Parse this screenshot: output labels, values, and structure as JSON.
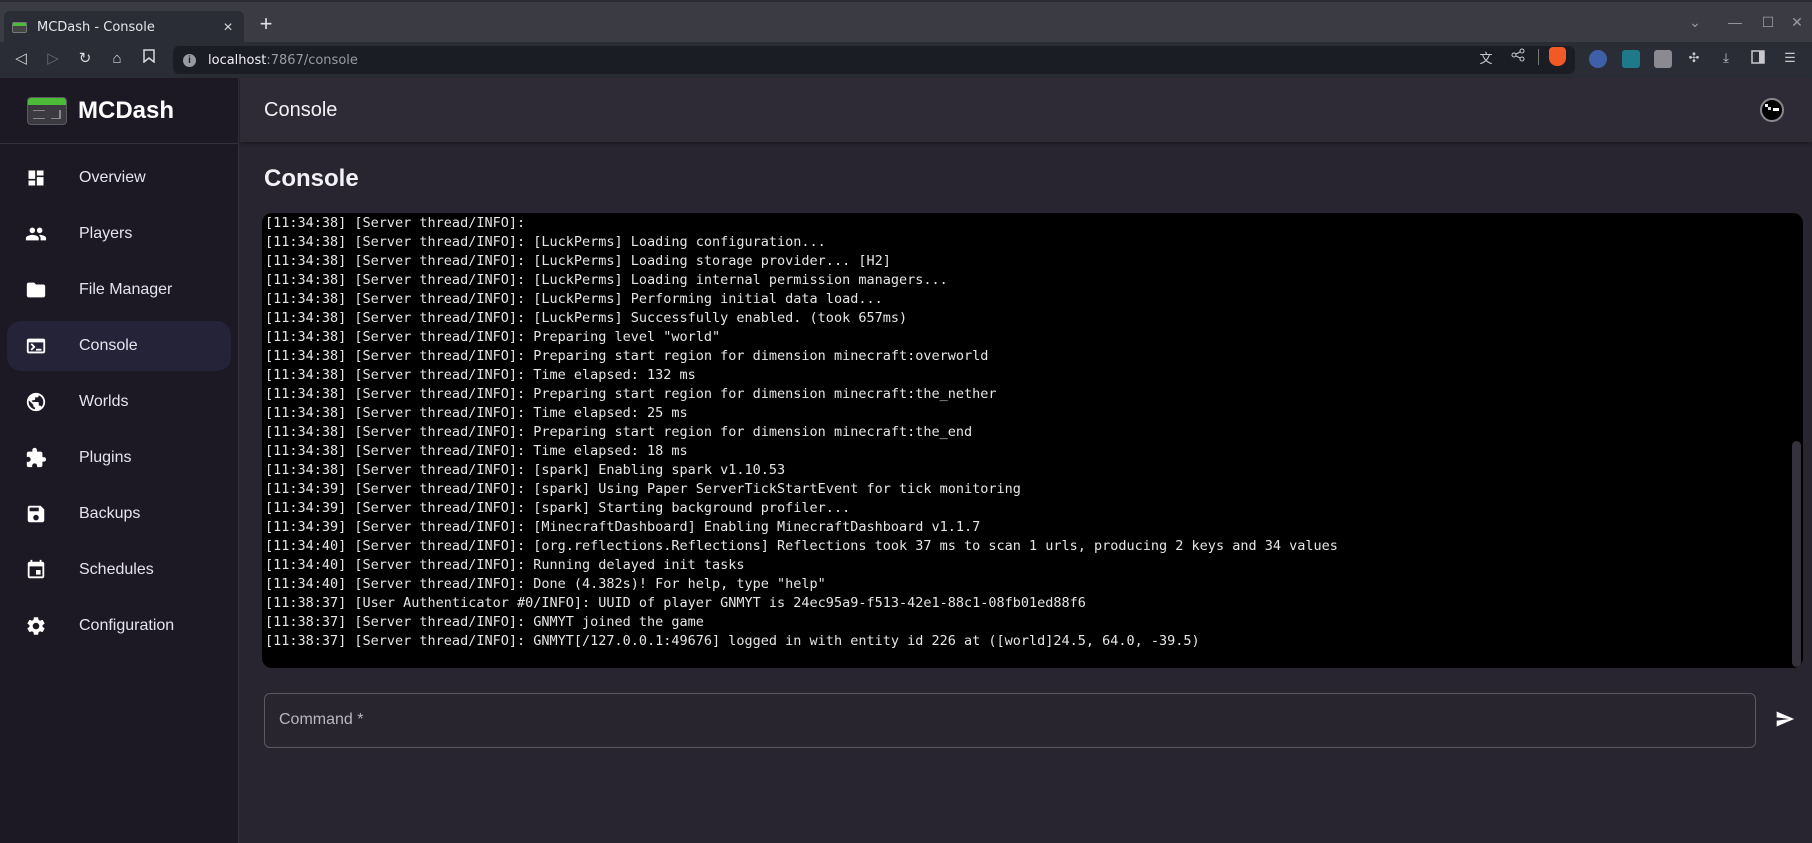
{
  "browser": {
    "tab_title": "MCDash - Console",
    "tab_close": "×",
    "new_tab": "+",
    "url_host": "localhost",
    "url_path": ":7867/console",
    "controls": {
      "dropdown": "⌄",
      "minimize": "—",
      "maximize": "☐",
      "close": "✕"
    },
    "nav": {
      "back": "◁",
      "forward": "▷",
      "reload": "↻",
      "home": "⌂",
      "bookmark": "🔖"
    }
  },
  "app": {
    "brand": "MCDash",
    "header_title": "Console",
    "page_title": "Console"
  },
  "sidebar": {
    "items": [
      {
        "label": "Overview",
        "icon": "dashboard-icon",
        "active": false
      },
      {
        "label": "Players",
        "icon": "people-icon",
        "active": false
      },
      {
        "label": "File Manager",
        "icon": "folder-icon",
        "active": false
      },
      {
        "label": "Console",
        "icon": "terminal-icon",
        "active": true
      },
      {
        "label": "Worlds",
        "icon": "globe-icon",
        "active": false
      },
      {
        "label": "Plugins",
        "icon": "puzzle-icon",
        "active": false
      },
      {
        "label": "Backups",
        "icon": "save-icon",
        "active": false
      },
      {
        "label": "Schedules",
        "icon": "calendar-icon",
        "active": false
      },
      {
        "label": "Configuration",
        "icon": "gear-icon",
        "active": false
      }
    ]
  },
  "console": {
    "lines": [
      "[11:34:38] [Server thread/INFO]: ",
      "[11:34:38] [Server thread/INFO]: [LuckPerms] Loading configuration...",
      "[11:34:38] [Server thread/INFO]: [LuckPerms] Loading storage provider... [H2]",
      "[11:34:38] [Server thread/INFO]: [LuckPerms] Loading internal permission managers...",
      "[11:34:38] [Server thread/INFO]: [LuckPerms] Performing initial data load...",
      "[11:34:38] [Server thread/INFO]: [LuckPerms] Successfully enabled. (took 657ms)",
      "[11:34:38] [Server thread/INFO]: Preparing level \"world\"",
      "[11:34:38] [Server thread/INFO]: Preparing start region for dimension minecraft:overworld",
      "[11:34:38] [Server thread/INFO]: Time elapsed: 132 ms",
      "[11:34:38] [Server thread/INFO]: Preparing start region for dimension minecraft:the_nether",
      "[11:34:38] [Server thread/INFO]: Time elapsed: 25 ms",
      "[11:34:38] [Server thread/INFO]: Preparing start region for dimension minecraft:the_end",
      "[11:34:38] [Server thread/INFO]: Time elapsed: 18 ms",
      "[11:34:38] [Server thread/INFO]: [spark] Enabling spark v1.10.53",
      "[11:34:39] [Server thread/INFO]: [spark] Using Paper ServerTickStartEvent for tick monitoring",
      "[11:34:39] [Server thread/INFO]: [spark] Starting background profiler...",
      "[11:34:39] [Server thread/INFO]: [MinecraftDashboard] Enabling MinecraftDashboard v1.1.7",
      "[11:34:40] [Server thread/INFO]: [org.reflections.Reflections] Reflections took 37 ms to scan 1 urls, producing 2 keys and 34 values",
      "[11:34:40] [Server thread/INFO]: Running delayed init tasks",
      "[11:34:40] [Server thread/INFO]: Done (4.382s)! For help, type \"help\"",
      "[11:38:37] [User Authenticator #0/INFO]: UUID of player GNMYT is 24ec95a9-f513-42e1-88c1-08fb01ed88f6",
      "[11:38:37] [Server thread/INFO]: GNMYT joined the game",
      "[11:38:37] [Server thread/INFO]: GNMYT[/127.0.0.1:49676] logged in with entity id 226 at ([world]24.5, 64.0, -39.5)"
    ]
  },
  "command": {
    "label": "Command *",
    "value": ""
  },
  "colors": {
    "accent_grass": "#4cbb37",
    "sidebar_bg": "#1c1924",
    "main_bg": "#282530",
    "active_item_bg": "#252338",
    "console_bg": "#000000"
  }
}
